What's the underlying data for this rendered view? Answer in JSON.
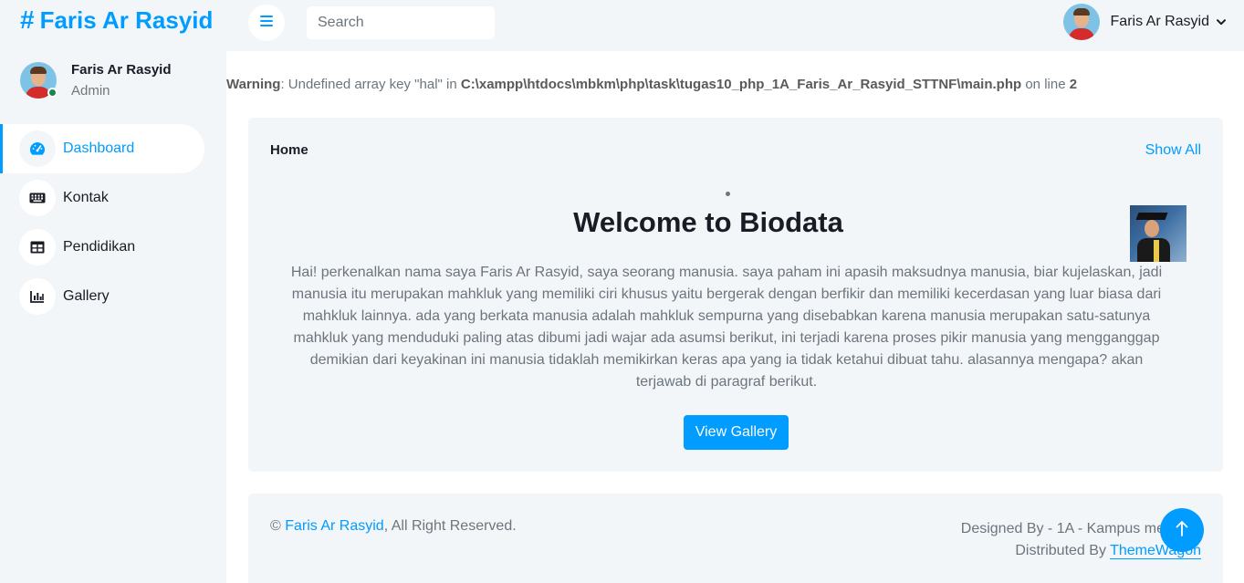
{
  "brand": {
    "symbol": "#",
    "name": "Faris Ar Rasyid"
  },
  "profile": {
    "name": "Faris Ar Rasyid",
    "role": "Admin",
    "status": "online"
  },
  "nav": {
    "items": [
      {
        "label": "Dashboard",
        "icon": "tachometer-icon",
        "active": true
      },
      {
        "label": "Kontak",
        "icon": "keyboard-icon",
        "active": false
      },
      {
        "label": "Pendidikan",
        "icon": "table-icon",
        "active": false
      },
      {
        "label": "Gallery",
        "icon": "chart-bar-icon",
        "active": false
      }
    ]
  },
  "topbar": {
    "menu_icon": "bars-icon",
    "search": {
      "placeholder": "Search",
      "value": ""
    },
    "user_name": "Faris Ar Rasyid"
  },
  "warning": {
    "label": "Warning",
    "message": ": Undefined array key \"hal\" in ",
    "path": "C:\\xampp\\htdocs\\mbkm\\php\\task\\tugas10_php_1A_Faris_Ar_Rasyid_STTNF\\main.php",
    "on_line": " on line ",
    "line": "2"
  },
  "card": {
    "title": "Home",
    "show_all": "Show All",
    "heading": "Welcome to Biodata",
    "intro": "Hai! perkenalkan nama saya Faris Ar Rasyid, saya seorang manusia. saya paham ini apasih maksudnya manusia, biar kujelaskan, jadi manusia itu merupakan mahkluk yang memiliki ciri khusus yaitu bergerak dengan berfikir dan memiliki kecerdasan yang luar biasa dari mahkluk lainnya. ada yang berkata manusia adalah mahkluk sempurna yang disebabkan karena manusia merupakan satu-satunya mahkluk yang menduduki paling atas dibumi jadi wajar ada asumsi berikut, ini terjadi karena proses pikir manusia yang mengganggap demikian dari keyakinan ini manusia tidaklah memikirkan keras apa yang ia tidak ketahui dibuat tahu. alasannya mengapa? akan terjawab di paragraf berikut.",
    "button": "View Gallery"
  },
  "footer": {
    "copy_symbol": "© ",
    "owner": "Faris Ar Rasyid",
    "rights": ", All Right Reserved.",
    "designed_by": "Designed By - 1A - Kampus merdeka",
    "distributed_prefix": "Distributed By ",
    "distributor": "ThemeWagon"
  },
  "colors": {
    "primary": "#009cff",
    "panel": "#f3f6f9",
    "dark": "#191c24",
    "muted": "#6c757d"
  }
}
